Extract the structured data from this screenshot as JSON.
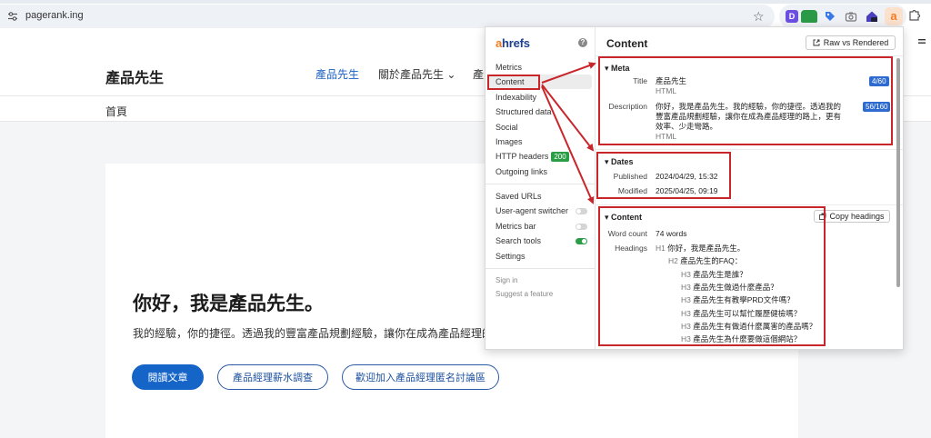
{
  "browser": {
    "url": "pagerank.ing",
    "extensions": [
      {
        "name": "d-extension-icon",
        "letter": "D",
        "color": "#6c4fe0"
      },
      {
        "name": "android-extension-icon",
        "letter": "",
        "color": "#2b9a46"
      },
      {
        "name": "tag-extension-icon",
        "letter": "",
        "color": "#3b78e7"
      },
      {
        "name": "camera-extension-icon",
        "letter": "",
        "color": "#777777"
      },
      {
        "name": "home-extension-icon",
        "letter": "",
        "color": "#4a3fbf"
      },
      {
        "name": "ahrefs-extension-icon",
        "letter": "a",
        "color": "#f27b22"
      }
    ]
  },
  "site": {
    "logo": "產品先生",
    "nav": [
      "產品先生",
      "關於產品先生",
      "產"
    ],
    "breadcrumb": "首頁",
    "hero_title": "你好，我是產品先生。",
    "hero_desc": "我的經驗，你的捷徑。透過我的豐富產品規劃經驗，讓你在成為產品經理的路",
    "buttons": [
      "閱讀文章",
      "產品經理薪水調查",
      "歡迎加入產品經理匿名討論區"
    ]
  },
  "ahrefs": {
    "logo_a": "a",
    "logo_rest": "hrefs",
    "sidebar": [
      "Metrics",
      "Content",
      "Indexability",
      "Structured data",
      "Social",
      "Images",
      "HTTP headers",
      "Outgoing links"
    ],
    "http_badge": "200",
    "tools": [
      "Saved URLs",
      "User-agent switcher",
      "Metrics bar",
      "Search tools",
      "Settings"
    ],
    "footer_links": [
      "Sign in",
      "Suggest a feature"
    ],
    "panel_title": "Content",
    "raw_vs_rendered": "Raw vs Rendered",
    "meta": {
      "section": "Meta",
      "title_label": "Title",
      "title_value": "產品先生",
      "title_type": "HTML",
      "title_count": "4/60",
      "desc_label": "Description",
      "desc_line1": "你好，我是產品先生。我的經驗，你的捷徑。透過我的",
      "desc_line2": "豐富產品規劃經驗，讓你在成為產品經理的路上，更有",
      "desc_line3": "效率、少走彎路。",
      "desc_type": "HTML",
      "desc_count": "56/160"
    },
    "dates": {
      "section": "Dates",
      "published_label": "Published",
      "published_value": "2024/04/29, 15:32",
      "modified_label": "Modified",
      "modified_value": "2025/04/25, 09:19"
    },
    "content": {
      "section": "Content",
      "copy_headings": "Copy headings",
      "word_count_label": "Word count",
      "word_count_value": "74 words",
      "headings_label": "Headings",
      "headings": [
        {
          "level": "H1",
          "text": "你好，我是產品先生。"
        },
        {
          "level": "H2",
          "text": "產品先生的FAQ："
        },
        {
          "level": "H3",
          "text": "產品先生是誰？"
        },
        {
          "level": "H3",
          "text": "產品先生做過什麼產品？"
        },
        {
          "level": "H3",
          "text": "產品先生有教學PRD文件嗎？"
        },
        {
          "level": "H3",
          "text": "產品先生可以幫忙履歷健檢嗎？"
        },
        {
          "level": "H3",
          "text": "產品先生有做過什麼厲害的產品嗎？"
        },
        {
          "level": "H3",
          "text": "產品先生為什麼要做這個網站？"
        }
      ]
    }
  },
  "colors": {
    "annotation_red": "#c9262b",
    "link_blue": "#1b62c4",
    "ahrefs_orange": "#f27b22",
    "ahrefs_navy": "#1d3f91",
    "count_badge_blue": "#2d6bd0",
    "status_green": "#2a9d47"
  }
}
